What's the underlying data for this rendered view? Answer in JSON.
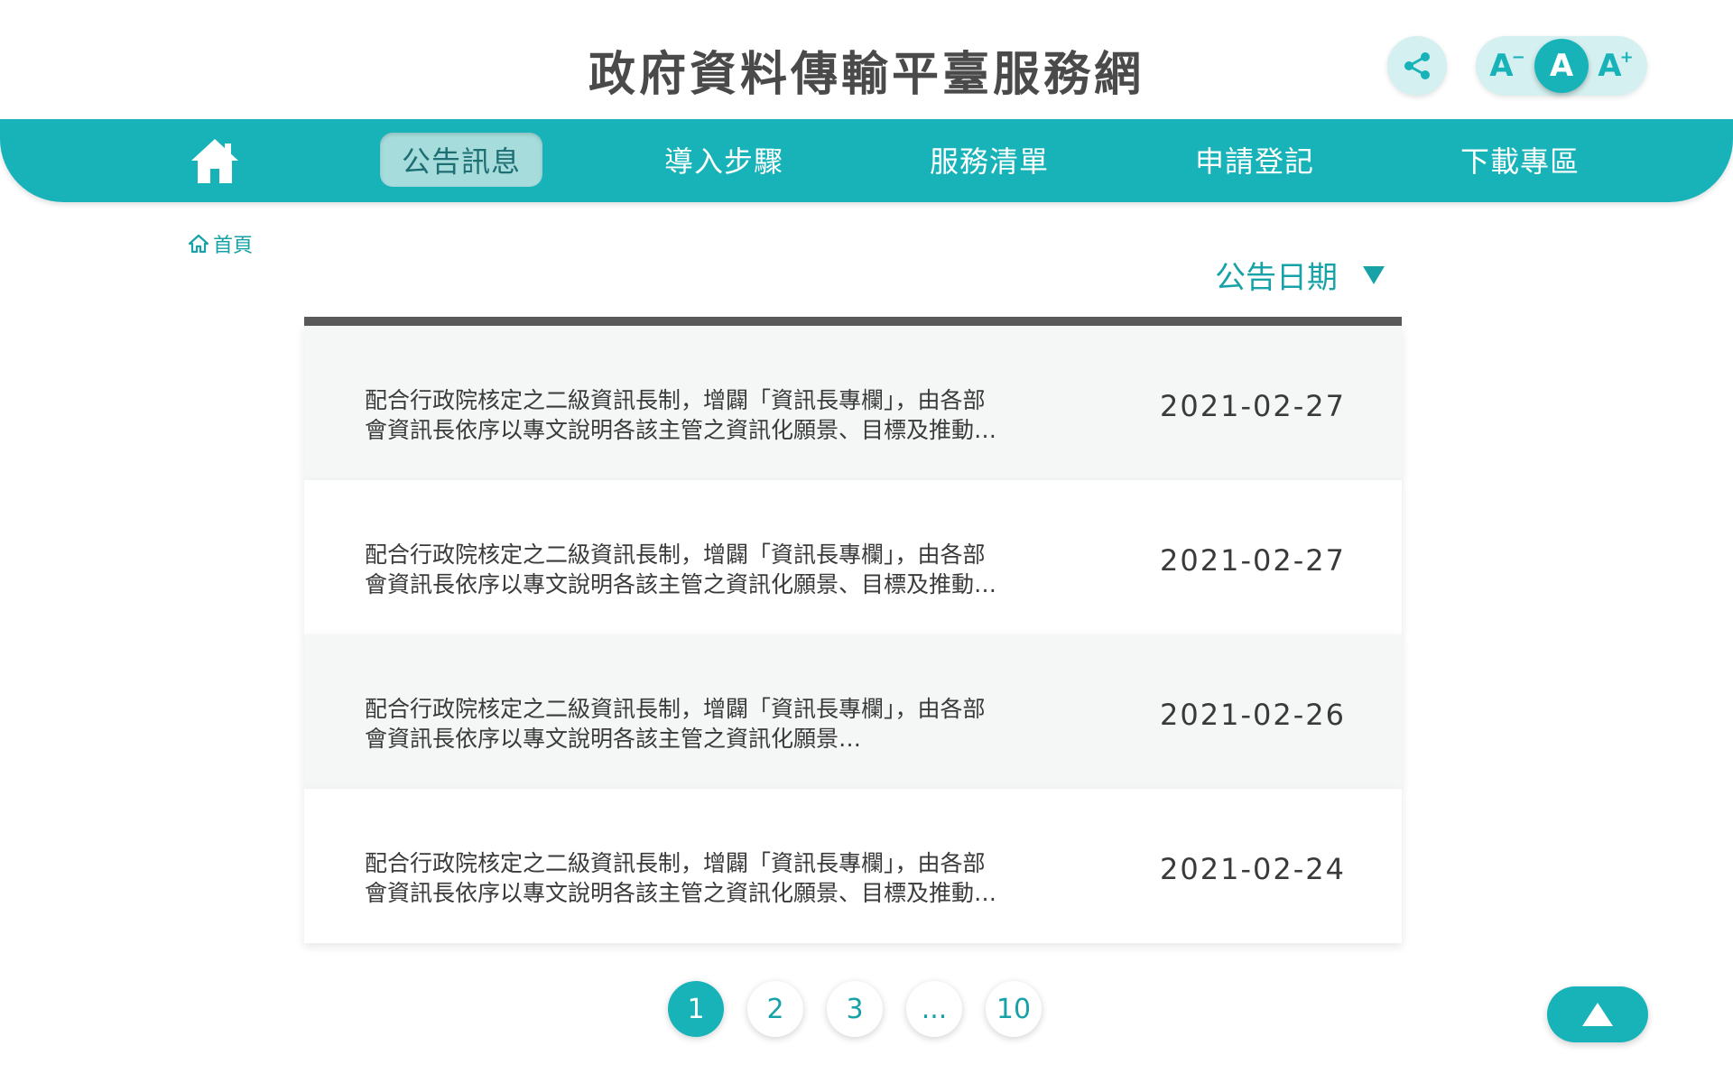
{
  "header": {
    "title": "政府資料傳輸平臺服務網",
    "share_icon": "share-icon",
    "font_size": {
      "small": "A",
      "small_sup": "−",
      "medium": "A",
      "large": "A",
      "large_sup": "+",
      "selected": "medium"
    }
  },
  "nav": {
    "home_icon": "home-icon",
    "items": [
      {
        "label": "公告訊息",
        "active": true
      },
      {
        "label": "導入步驟",
        "active": false
      },
      {
        "label": "服務清單",
        "active": false
      },
      {
        "label": "申請登記",
        "active": false
      },
      {
        "label": "下載專區",
        "active": false
      }
    ]
  },
  "breadcrumb": {
    "icon": "home-outline-icon",
    "label": "首頁"
  },
  "sort": {
    "label": "公告日期",
    "icon": "triangle-down-icon"
  },
  "announcements": [
    {
      "line1": "配合行政院核定之二級資訊長制，增闢「資訊長專欄」，由各部",
      "line2": "會資訊長依序以專文說明各該主管之資訊化願景、目標及推動…",
      "date": "2021-02-27"
    },
    {
      "line1": "配合行政院核定之二級資訊長制，增闢「資訊長專欄」，由各部",
      "line2": "會資訊長依序以專文說明各該主管之資訊化願景、目標及推動…",
      "date": "2021-02-27"
    },
    {
      "line1": "配合行政院核定之二級資訊長制，增闢「資訊長專欄」，由各部",
      "line2": "會資訊長依序以專文說明各該主管之資訊化願景…",
      "date": "2021-02-26"
    },
    {
      "line1": "配合行政院核定之二級資訊長制，增闢「資訊長專欄」，由各部",
      "line2": "會資訊長依序以專文說明各該主管之資訊化願景、目標及推動…",
      "date": "2021-02-24"
    }
  ],
  "pagination": {
    "pages": [
      "1",
      "2",
      "3",
      "...",
      "10"
    ],
    "current": "1"
  },
  "back_to_top": {
    "icon": "arrow-up-icon"
  },
  "colors": {
    "accent": "#17b3b8",
    "accent_text": "#17a2a8",
    "nav_active_bg": "#a6dcdc",
    "title_text": "#4a4a4a",
    "row_shaded": "#f5f7f7",
    "list_topbar": "#5a5a5a"
  }
}
